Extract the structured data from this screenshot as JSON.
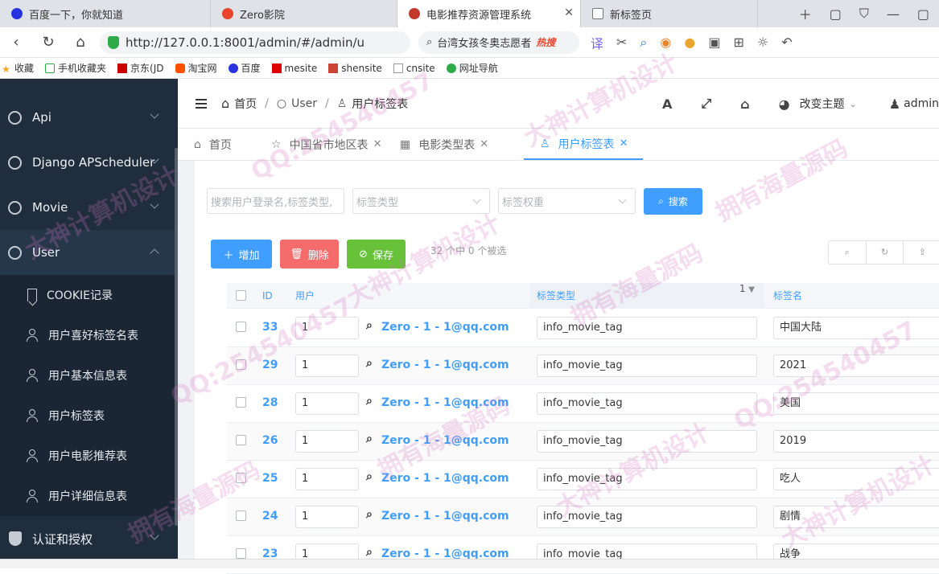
{
  "browser": {
    "tabs": [
      {
        "title": "百度一下，你就知道",
        "icon_color": "#2932e1"
      },
      {
        "title": "Zero影院",
        "icon_color": "#e8452c"
      },
      {
        "title": "电影推荐资源管理系统",
        "icon_color": "#c0392b"
      },
      {
        "title": "新标签页",
        "icon_color": "#777777"
      }
    ],
    "url": "http://127.0.0.1:8001/admin/#/admin/u",
    "search_text": "台湾女孩冬奥志愿者",
    "search_badge": "热搜",
    "bookmarks": [
      "收藏",
      "手机收藏夹",
      "京东(JD",
      "淘宝网",
      "百度",
      "mesite",
      "shensite",
      "cnsite",
      "网址导航"
    ]
  },
  "sidebar": {
    "groups": [
      {
        "label": "Api"
      },
      {
        "label": "Django APScheduler"
      },
      {
        "label": "Movie"
      },
      {
        "label": "User"
      }
    ],
    "sub_items": [
      {
        "label": "COOKIE记录",
        "icon": "bookmark-icon"
      },
      {
        "label": "用户喜好标签名表",
        "icon": "user-icon"
      },
      {
        "label": "用户基本信息表",
        "icon": "user-icon"
      },
      {
        "label": "用户标签表",
        "icon": "user-icon"
      },
      {
        "label": "用户电影推荐表",
        "icon": "user-icon"
      },
      {
        "label": "用户详细信息表",
        "icon": "user-icon"
      }
    ],
    "auth_group": "认证和授权"
  },
  "header": {
    "breadcrumb": [
      "首页",
      "User",
      "用户标签表"
    ],
    "theme_label": "改变主题",
    "user": "admin"
  },
  "page_tabs": [
    {
      "label": "首页",
      "icon": "home-icon",
      "closable": false
    },
    {
      "label": "中国省市地区表",
      "icon": "star-icon",
      "closable": true
    },
    {
      "label": "电影类型表",
      "icon": "film-icon",
      "closable": true
    },
    {
      "label": "用户标签表",
      "icon": "user-icon",
      "closable": true
    }
  ],
  "filters": {
    "search_placeholder": "搜索用户登录名,标签类型,",
    "type_placeholder": "标签类型",
    "weight_placeholder": "标签权重",
    "search_button": "搜索"
  },
  "actions": {
    "add": "增加",
    "delete": "删除",
    "save": "保存",
    "selection_info": "32 个中 0 个被选"
  },
  "table": {
    "columns": {
      "id": "ID",
      "user": "用户",
      "tag_type": "标签类型",
      "tag_name": "标签名"
    },
    "sort_index": "1",
    "rows": [
      {
        "id": "33",
        "user": "1",
        "user_link": "Zero - 1 - 1@qq.com",
        "tag_type": "info_movie_tag",
        "tag_name": "中国大陆"
      },
      {
        "id": "29",
        "user": "1",
        "user_link": "Zero - 1 - 1@qq.com",
        "tag_type": "info_movie_tag",
        "tag_name": "2021"
      },
      {
        "id": "28",
        "user": "1",
        "user_link": "Zero - 1 - 1@qq.com",
        "tag_type": "info_movie_tag",
        "tag_name": "美国"
      },
      {
        "id": "26",
        "user": "1",
        "user_link": "Zero - 1 - 1@qq.com",
        "tag_type": "info_movie_tag",
        "tag_name": "2019"
      },
      {
        "id": "25",
        "user": "1",
        "user_link": "Zero - 1 - 1@qq.com",
        "tag_type": "info_movie_tag",
        "tag_name": "吃人"
      },
      {
        "id": "24",
        "user": "1",
        "user_link": "Zero - 1 - 1@qq.com",
        "tag_type": "info_movie_tag",
        "tag_name": "剧情"
      },
      {
        "id": "23",
        "user": "1",
        "user_link": "Zero - 1 - 1@qq.com",
        "tag_type": "info_movie_tag",
        "tag_name": "战争"
      }
    ]
  },
  "watermarks": [
    "QQ:254540457",
    "大神计算机设计",
    "拥有海量源码"
  ],
  "colors": {
    "accent": "#409eff",
    "sidebar": "#1f2d3d",
    "danger": "#f56c6c",
    "success": "#67c23a"
  }
}
